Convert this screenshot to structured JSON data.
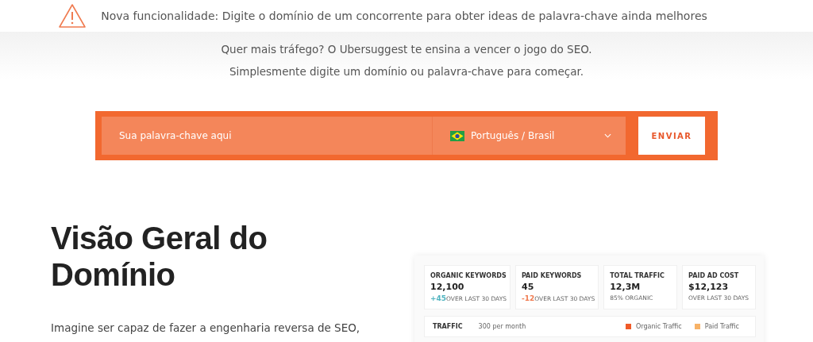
{
  "notice": {
    "text": "Nova funcionalidade: Digite o domínio de um concorrente para obter ideas de palavra-chave ainda melhores"
  },
  "intro": [
    "Quer mais tráfego? O Ubersuggest te ensina a vencer o jogo do SEO.",
    "Simplesmente digite um domínio ou palavra-chave para começar."
  ],
  "search": {
    "placeholder": "Sua palavra-chave aqui",
    "language": "Português / Brasil",
    "button": "ENVIAR"
  },
  "section": {
    "heading": "Visão Geral do Domínio",
    "text": "Imagine ser capaz de fazer a engenharia reversa de SEO,"
  },
  "dashboard": {
    "stats": [
      {
        "label": "ORGANIC KEYWORDS",
        "value": "12,100",
        "delta": "+45",
        "color": "#4fb3bf",
        "note": "OVER LAST 30 DAYS"
      },
      {
        "label": "PAID KEYWORDS",
        "value": "45",
        "delta": "-12",
        "color": "#f07b50",
        "note": "OVER LAST 30 DAYS"
      },
      {
        "label": "TOTAL TRAFFIC",
        "value": "12,3M",
        "note": "85% ORGANIC"
      },
      {
        "label": "PAID AD COST",
        "value": "$12,123",
        "note": "OVER LAST 30 DAYS"
      }
    ],
    "traffic": {
      "label": "TRAFFIC",
      "value": "300 per month",
      "legend": [
        {
          "label": "Organic Traffic",
          "color": "#f05a28"
        },
        {
          "label": "Paid Traffic",
          "color": "#f7b267"
        }
      ]
    }
  }
}
